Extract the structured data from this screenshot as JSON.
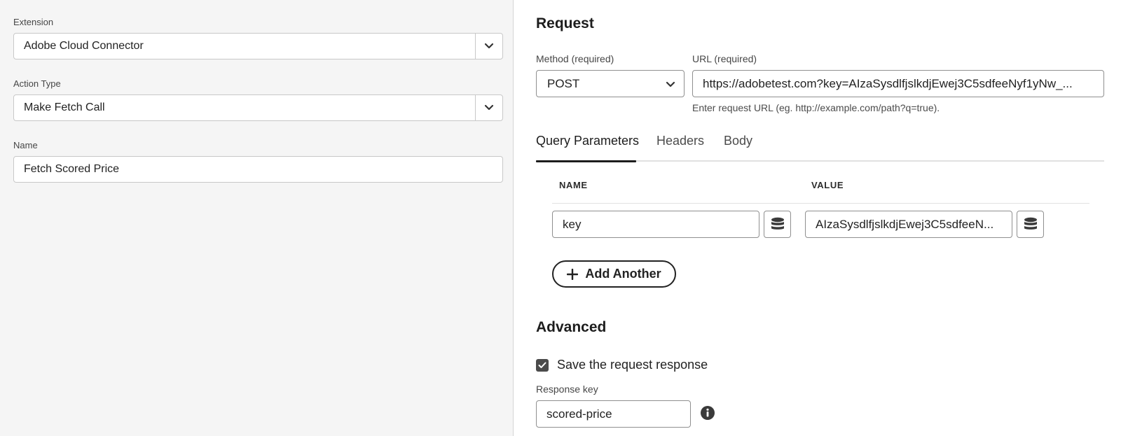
{
  "left": {
    "extension": {
      "label": "Extension",
      "value": "Adobe Cloud Connector"
    },
    "action_type": {
      "label": "Action Type",
      "value": "Make Fetch Call"
    },
    "name": {
      "label": "Name",
      "value": "Fetch Scored Price"
    }
  },
  "request": {
    "heading": "Request",
    "method": {
      "label": "Method (required)",
      "value": "POST"
    },
    "url": {
      "label": "URL (required)",
      "value": "https://adobetest.com?key=AIzaSysdlfjslkdjEwej3C5sdfeeNyf1yNw_...",
      "help": "Enter request URL (eg. http://example.com/path?q=true)."
    },
    "tabs": [
      {
        "label": "Query Parameters",
        "active": true
      },
      {
        "label": "Headers",
        "active": false
      },
      {
        "label": "Body",
        "active": false
      }
    ],
    "table": {
      "name_header": "NAME",
      "value_header": "VALUE",
      "rows": [
        {
          "name": "key",
          "value": "AIzaSysdlfjslkdjEwej3C5sdfeeN..."
        }
      ]
    },
    "add_another": "Add Another"
  },
  "advanced": {
    "heading": "Advanced",
    "save_response_label": "Save the request response",
    "save_response_checked": true,
    "response_key": {
      "label": "Response key",
      "value": "scored-price"
    }
  },
  "icons": {
    "chevron": "chevron-down-icon",
    "data_element": "database-icon",
    "add": "plus-icon",
    "info": "info-icon",
    "check": "checkmark-icon"
  }
}
